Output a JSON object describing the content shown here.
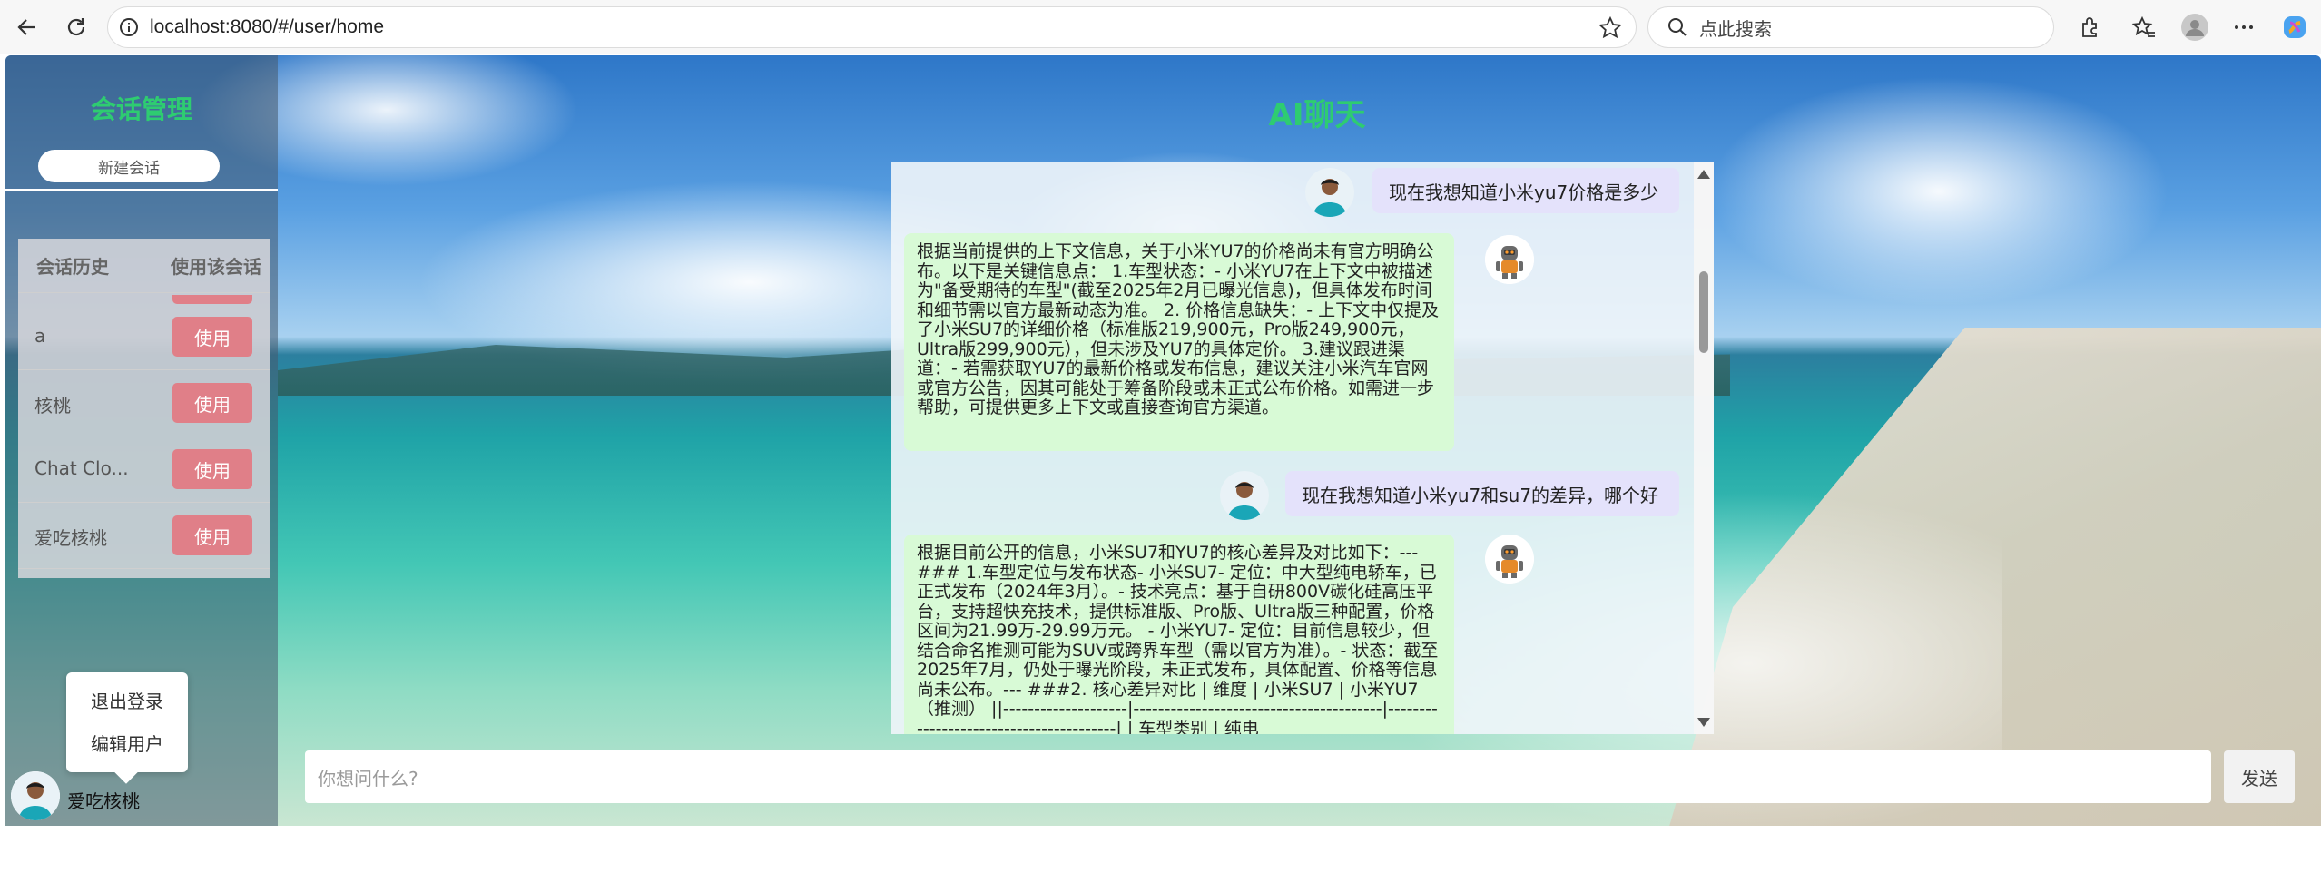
{
  "browser": {
    "url": "localhost:8080/#/user/home",
    "search_placeholder": "点此搜索"
  },
  "sidebar": {
    "title": "会话管理",
    "new_session": "新建会话",
    "history_header": "会话历史",
    "use_header": "使用该会话",
    "sessions": [
      {
        "name": "a",
        "action": "使用"
      },
      {
        "name": "核桃",
        "action": "使用"
      },
      {
        "name": "Chat Clo...",
        "action": "使用"
      },
      {
        "name": "爱吃核桃",
        "action": "使用"
      }
    ],
    "menu": {
      "logout": "退出登录",
      "edit_user": "编辑用户"
    },
    "username": "爱吃核桃"
  },
  "main": {
    "title": "AI聊天",
    "messages": [
      {
        "role": "user",
        "text": "现在我想知道小米yu7价格是多少"
      },
      {
        "role": "ai",
        "text": "根据当前提供的上下文信息，关于小米YU7的价格尚未有官方明确公布。以下是关键信息点： 1.车型状态：- 小米YU7在上下文中被描述为\"备受期待的车型\"(截至2025年2月已曝光信息)，但具体发布时间和细节需以官方最新动态为准。 2. 价格信息缺失：- 上下文中仅提及了小米SU7的详细价格（标准版219,900元，Pro版249,900元，Ultra版299,900元），但未涉及YU7的具体定价。 3.建议跟进渠道：- 若需获取YU7的最新价格或发布信息，建议关注小米汽车官网或官方公告，因其可能处于筹备阶段或未正式公布价格。如需进一步帮助，可提供更多上下文或直接查询官方渠道。"
      },
      {
        "role": "user",
        "text": "现在我想知道小米yu7和su7的差异，哪个好"
      },
      {
        "role": "ai",
        "text": "根据目前公开的信息，小米SU7和YU7的核心差异及对比如下：--- ### 1.车型定位与发布状态- 小米SU7- 定位：中大型纯电轿车，已正式发布（2024年3月）。- 技术亮点：基于自研800V碳化硅高压平台，支持超快充技术，提供标准版、Pro版、Ultra版三种配置，价格区间为21.99万-29.99万元。 - 小米YU7- 定位：目前信息较少，但结合命名推测可能为SUV或跨界车型（需以官方为准）。- 状态：截至2025年7月，仍处于曝光阶段，未正式发布，具体配置、价格等信息尚未公布。--- ###2. 核心差异对比 | 维度 | 小米SU7 | 小米YU7（推测） ||--------------------|----------------------------------------|----------------------------------------| | 车型类别 | 纯电"
      }
    ],
    "input_placeholder": "你想问什么?",
    "send": "发送"
  }
}
